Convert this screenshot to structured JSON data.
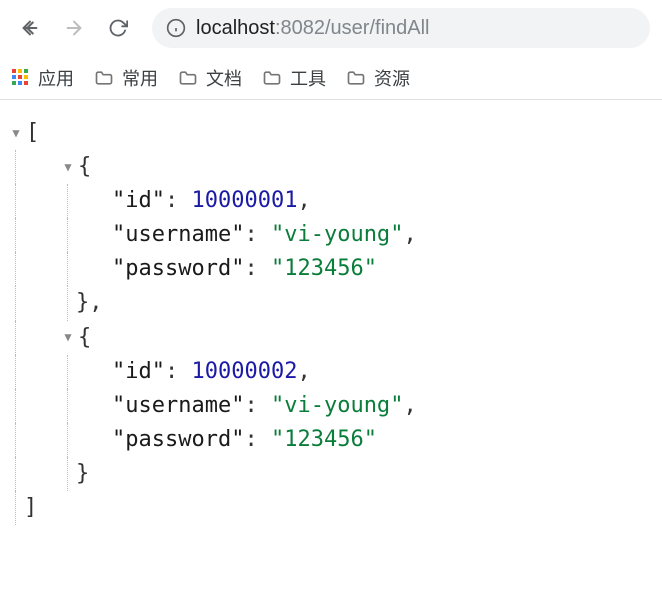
{
  "address": {
    "host": "localhost",
    "port": ":8082",
    "path": "/user/findAll"
  },
  "bookmarks": {
    "apps": "应用",
    "folders": [
      "常用",
      "文档",
      "工具",
      "资源"
    ]
  },
  "json": {
    "items": [
      {
        "id": 10000001,
        "username": "vi-young",
        "password": "123456"
      },
      {
        "id": 10000002,
        "username": "vi-young",
        "password": "123456"
      }
    ],
    "keys": {
      "id": "id",
      "username": "username",
      "password": "password"
    }
  }
}
